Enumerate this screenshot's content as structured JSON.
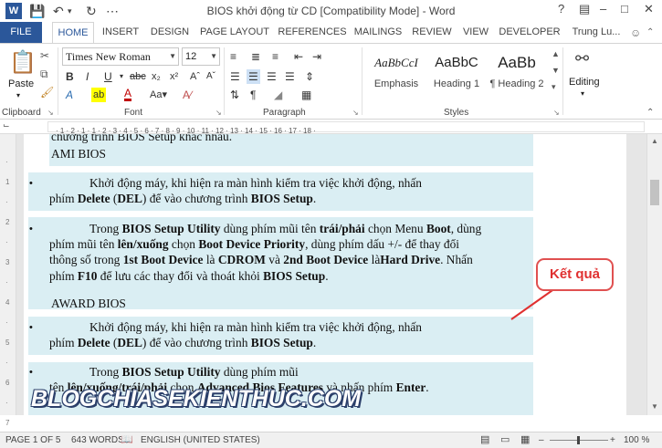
{
  "window": {
    "title": "BIOS khởi động từ CD [Compatibility Mode] - Word",
    "user": "Trung Lu...",
    "help": "?"
  },
  "tabs": [
    "FILE",
    "HOME",
    "INSERT",
    "DESIGN",
    "PAGE LAYOUT",
    "REFERENCES",
    "MAILINGS",
    "REVIEW",
    "VIEW",
    "DEVELOPER"
  ],
  "ribbon": {
    "clipboard": {
      "paste": "Paste",
      "label": "Clipboard"
    },
    "font": {
      "name": "Times New Roman",
      "size": "12",
      "label": "Font"
    },
    "paragraph": {
      "label": "Paragraph"
    },
    "styles": {
      "label": "Styles",
      "items": [
        {
          "preview": "AaBbCcI",
          "name": "Emphasis"
        },
        {
          "preview": "AaBbC",
          "name": "Heading 1"
        },
        {
          "preview": "AaBb",
          "name": "¶ Heading 2"
        }
      ]
    },
    "editing": {
      "label": "Editing"
    }
  },
  "document": {
    "top_clip": "chương trình BIOS Setup khác nhau.",
    "h_ami": "AMI BIOS",
    "ami1_l1": "Khởi động máy, khi hiện ra màn hình kiểm tra việc khởi động, nhấn",
    "ami1_l2_a": "phím ",
    "ami1_l2_b": "Delete",
    "ami1_l2_c": " (",
    "ami1_l2_d": "DEL",
    "ami1_l2_e": ") để vào chương trình ",
    "ami1_l2_f": "BIOS Setup",
    "ami1_l2_g": ".",
    "ami2_l1_a": "Trong ",
    "ami2_l1_b": "BIOS Setup Utility",
    "ami2_l1_c": " dùng phím mũi tên ",
    "ami2_l1_d": "trái/phải",
    "ami2_l1_e": " chọn Menu ",
    "ami2_l1_f": "Boot",
    "ami2_l1_g": ", dùng",
    "ami2_l2_a": "phím mũi tên ",
    "ami2_l2_b": "lên/xuống",
    "ami2_l2_c": " chọn ",
    "ami2_l2_d": "Boot Device Priority",
    "ami2_l2_e": ", dùng phím dấu +/- để thay đổi",
    "ami2_l3_a": "thông số trong ",
    "ami2_l3_b": "1st Boot Device",
    "ami2_l3_c": " là ",
    "ami2_l3_d": "CDROM",
    "ami2_l3_e": " và ",
    "ami2_l3_f": "2nd Boot Device",
    "ami2_l3_g": " là",
    "ami2_l3_h": "Hard Drive",
    "ami2_l3_i": ". Nhấn",
    "ami2_l4_a": "phím ",
    "ami2_l4_b": "F10",
    "ami2_l4_c": " để lưu các thay đổi và thoát khỏi ",
    "ami2_l4_d": "BIOS Setup",
    "ami2_l4_e": ".",
    "h_award": "AWARD BIOS",
    "aw1_l1": "Khởi động máy, khi hiện ra màn hình kiểm tra việc khởi động, nhấn",
    "aw1_l2_a": "phím ",
    "aw1_l2_b": "Delete",
    "aw1_l2_c": " (",
    "aw1_l2_d": "DEL",
    "aw1_l2_e": ") để vào chương trình ",
    "aw1_l2_f": "BIOS Setup",
    "aw1_l2_g": ".",
    "aw2_l1_a": "Trong ",
    "aw2_l1_b": "BIOS Setup Utility",
    "aw2_l1_c": " dùng phím mũi",
    "aw2_l2_a": "tên ",
    "aw2_l2_b": "lên/xuống/trái/phải",
    "aw2_l2_c": " chọn ",
    "aw2_l2_d": "Advanced Bios Features",
    "aw2_l2_e": " và nhấn phím ",
    "aw2_l2_f": "Enter",
    "aw2_l2_g": ".",
    "bullet": "•"
  },
  "callout": "Kết quả",
  "watermark": "BLOGCHIASEKIENTHUC.COM",
  "status": {
    "page": "PAGE 1 OF 5",
    "words": "643 WORDS",
    "language": "ENGLISH (UNITED STATES)",
    "zoom": "100 %"
  },
  "colors": {
    "accent": "#2b579a",
    "highlight": "#daeef3",
    "callout": "#e03030"
  }
}
